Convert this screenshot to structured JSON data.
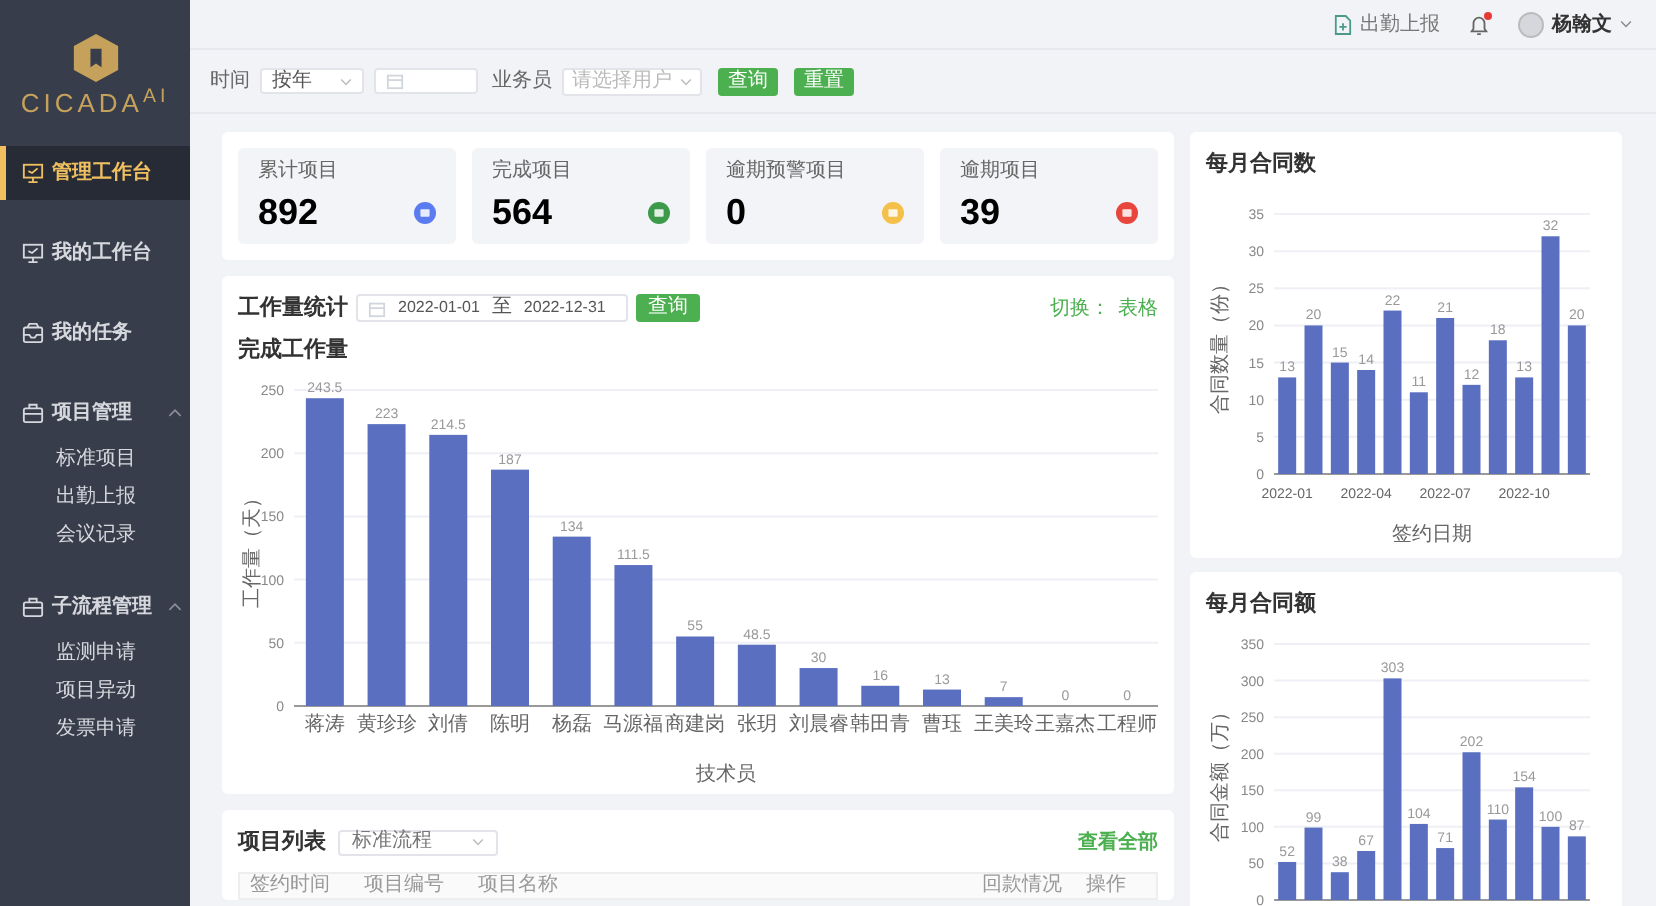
{
  "logo": {
    "text": "CICADA$^{AI}$"
  },
  "sidebar": {
    "items": [
      {
        "label": "管理工作台",
        "kind": "desk",
        "selected": true
      },
      {
        "label": "我的工作台",
        "kind": "desk",
        "selected": false
      },
      {
        "label": "我的任务",
        "kind": "task",
        "selected": false
      },
      {
        "label": "项目管理",
        "kind": "folder",
        "selected": false,
        "expanded": true,
        "children": [
          {
            "label": "标准项目",
            "selected": false
          },
          {
            "label": "出勤上报",
            "selected": false
          },
          {
            "label": "会议记录",
            "selected": false
          }
        ]
      },
      {
        "label": "子流程管理",
        "kind": "folder",
        "selected": false,
        "expanded": true,
        "children": [
          {
            "label": "监测申请",
            "selected": false
          },
          {
            "label": "项目异动",
            "selected": false
          },
          {
            "label": "发票申请",
            "selected": false
          }
        ]
      }
    ]
  },
  "header": {
    "report_link": "出勤上报",
    "notification_unread": true,
    "user_name": "杨翰文"
  },
  "filter": {
    "time_label": "时间",
    "period_value": "按年",
    "staff_label": "业务员",
    "staff_placeholder": "请选择用户",
    "buttons": [
      "查询",
      "重置"
    ]
  },
  "stats": [
    {
      "label": "累计项目",
      "value": "892",
      "color": "#5b7cf0"
    },
    {
      "label": "完成项目",
      "value": "564",
      "color": "#3c9a4a"
    },
    {
      "label": "逾期预警项目",
      "value": "0",
      "color": "#f5c04a"
    },
    {
      "label": "逾期项目",
      "value": "39",
      "color": "#e8453c"
    }
  ],
  "workload": {
    "title": "工作量统计",
    "date_from": "2022-01-01",
    "date_sep": "至",
    "date_to": "2022-12-31",
    "query_button": "查询",
    "switch_label": "切换：",
    "switch_link": "表格",
    "chart_data": {
      "type": "bar",
      "title": "完成工作量",
      "xlabel": "技术员",
      "ylabel": "工作量（天）",
      "categories": [
        "蒋涛",
        "黄珍珍",
        "刘倩",
        "陈明",
        "杨磊",
        "马源福",
        "商建岗",
        "张玥",
        "刘晨睿",
        "韩田青",
        "曹珏",
        "王美玲",
        "王嘉杰",
        "工程师"
      ],
      "series": [
        {
          "color": "#5a6fc0",
          "values": [
            243.5,
            223,
            214.5,
            187,
            134,
            111.5,
            55,
            48.5,
            30,
            16,
            13,
            7,
            0,
            0
          ]
        }
      ],
      "grid": true,
      "ylim": [
        0,
        250
      ],
      "yticks": [
        0,
        50,
        100,
        150,
        200,
        250
      ],
      "data_labels": true
    }
  },
  "monthly_count": {
    "chart_data": {
      "type": "bar",
      "title": "每月合同数",
      "xlabel": "签约日期",
      "ylabel": "合同数量（份）",
      "categories": [
        "2022-01",
        null,
        null,
        "2022-04",
        null,
        null,
        "2022-07",
        null,
        null,
        "2022-10",
        null,
        null
      ],
      "series": [
        {
          "color": "#5a6fc0",
          "values": [
            13,
            20,
            15,
            14,
            22,
            11,
            21,
            12,
            18,
            13,
            32,
            20
          ]
        }
      ],
      "grid": true,
      "ylim": [
        0,
        35
      ],
      "yticks": [
        0,
        5,
        10,
        15,
        20,
        25,
        30,
        35
      ],
      "data_labels": true
    }
  },
  "monthly_amount": {
    "chart_data": {
      "type": "bar",
      "title": "每月合同额",
      "ylabel": "合同金额（万）",
      "series": [
        {
          "color": "#5a6fc0",
          "values": [
            52,
            99,
            38,
            67,
            303,
            104,
            71,
            202,
            110,
            154,
            100,
            87
          ]
        }
      ],
      "grid": true,
      "ylim": [
        0,
        350
      ],
      "yticks": [
        0,
        50,
        100,
        150,
        200,
        250,
        300,
        350
      ],
      "data_labels": true
    }
  },
  "project_list": {
    "title": "项目列表",
    "filter_value": "标准流程",
    "view_all": "查看全部",
    "columns": [
      "签约时间",
      "项目编号",
      "项目名称",
      "回款情况",
      "操作"
    ]
  }
}
